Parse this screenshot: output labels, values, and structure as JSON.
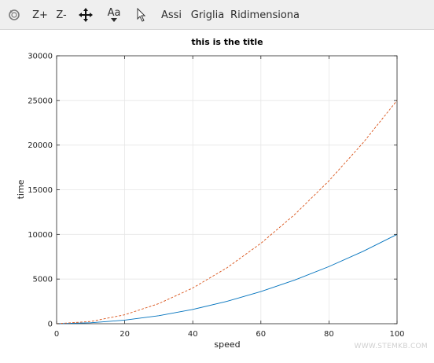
{
  "toolbar": {
    "icons": [
      "rotate-icon",
      "zoom-in-icon",
      "zoom-out-icon",
      "pan-icon",
      "text-icon",
      "pointer-icon"
    ],
    "zoom_in_label": "Z+",
    "zoom_out_label": "Z-",
    "text_icon_label": "Aa",
    "axes_label": "Assi",
    "grid_label": "Griglia",
    "resize_label": "Ridimensiona"
  },
  "chart_data": {
    "type": "line",
    "title": "this is the title",
    "xlabel": "speed",
    "ylabel": "time",
    "xlim": [
      0,
      100
    ],
    "ylim": [
      0,
      30000
    ],
    "xticks": [
      0,
      20,
      40,
      60,
      80,
      100
    ],
    "yticks": [
      0,
      5000,
      10000,
      15000,
      20000,
      25000,
      30000
    ],
    "grid": true,
    "series": [
      {
        "color": "#0072bd",
        "style": "solid",
        "x": [
          0,
          10,
          20,
          30,
          40,
          50,
          60,
          70,
          80,
          90,
          100
        ],
        "values": [
          0,
          100,
          400,
          900,
          1600,
          2500,
          3600,
          4900,
          6400,
          8100,
          10000
        ]
      },
      {
        "color": "#d95319",
        "style": "dashed",
        "x": [
          0,
          10,
          20,
          30,
          40,
          50,
          60,
          70,
          80,
          90,
          100
        ],
        "values": [
          0,
          250,
          1000,
          2250,
          4000,
          6250,
          9000,
          12250,
          16000,
          20250,
          25000
        ]
      }
    ]
  },
  "watermark": "WWW.STEMKB.COM"
}
